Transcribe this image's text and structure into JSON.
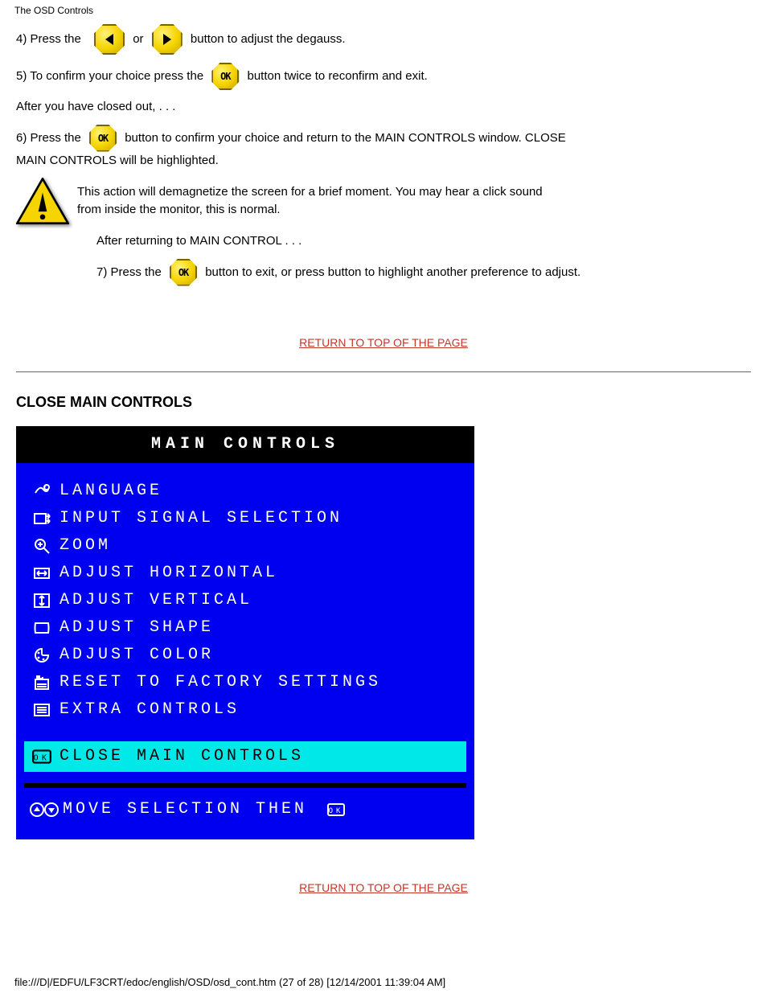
{
  "header_title": "The OSD Controls",
  "steps": {
    "s4_a": "4) Press the ",
    "s4_b": " or ",
    "s4_c": " button to adjust the degauss.",
    "s5_a": "5) To confirm your choice press the ",
    "s5_b": " button twice to reconfirm and exit.",
    "final": "After you have closed out, . . .",
    "s6_a": "6) Press the ",
    "s6_b": " button to confirm your choice and return to the MAIN CONTROLS window. CLOSE",
    "s6_c": "MAIN CONTROLS will be highlighted.",
    "warn_a": "This action will demagnetize the screen for a brief moment. You may hear a click sound",
    "warn_b": "from inside the monitor, this is normal.",
    "after_warn_a": "After returning to MAIN CONTROL . . .",
    "after_warn_b": "7) Press the ",
    "after_warn_c": " button to exit, or press button to highlight another preference to adjust.",
    "link1": "RETURN TO TOP OF THE PAGE",
    "close_heading": "CLOSE MAIN CONTROLS",
    "link2": "RETURN TO TOP OF THE PAGE"
  },
  "osd": {
    "title": "MAIN CONTROLS",
    "items": [
      {
        "icon": "lang",
        "label": "LANGUAGE"
      },
      {
        "icon": "input",
        "label": "INPUT SIGNAL SELECTION"
      },
      {
        "icon": "zoom",
        "label": "ZOOM"
      },
      {
        "icon": "horiz",
        "label": "ADJUST HORIZONTAL"
      },
      {
        "icon": "vert",
        "label": "ADJUST VERTICAL"
      },
      {
        "icon": "shape",
        "label": "ADJUST SHAPE"
      },
      {
        "icon": "color",
        "label": "ADJUST COLOR"
      },
      {
        "icon": "reset",
        "label": "RESET TO FACTORY SETTINGS"
      },
      {
        "icon": "extra",
        "label": "EXTRA CONTROLS"
      }
    ],
    "close_item": {
      "icon": "ok",
      "label": "CLOSE MAIN CONTROLS"
    },
    "footer_a": "MOVE SELECTION THEN",
    "footer_icon_lead": "arrows",
    "footer_icon_tail": "ok"
  },
  "footer": {
    "path": "file:///D|/EDFU/LF3CRT/edoc/english/OSD/osd_cont.htm (27 of 28) [12/14/2001 11:39:04 AM]"
  }
}
